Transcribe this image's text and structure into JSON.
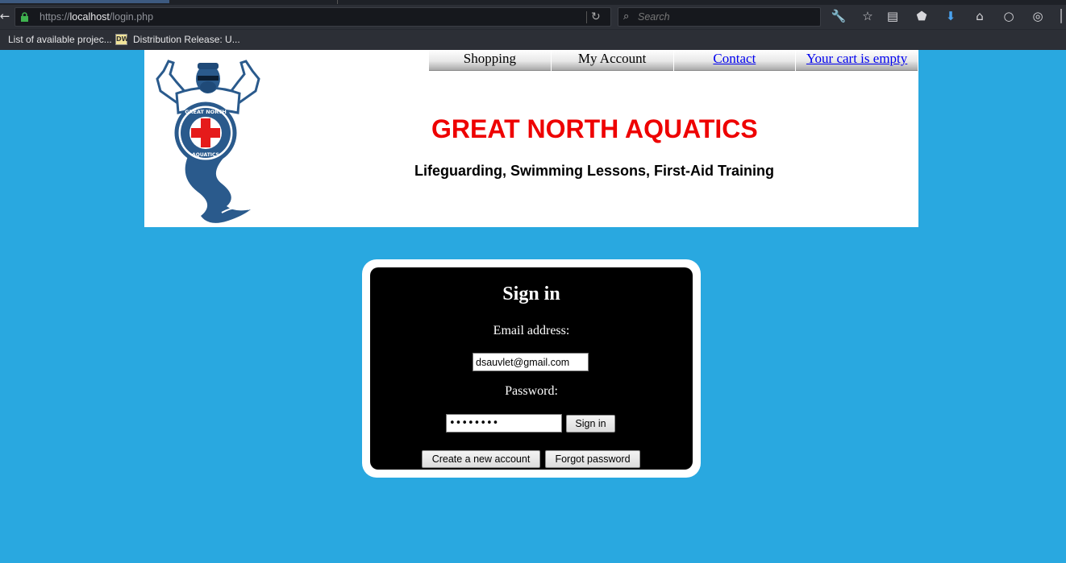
{
  "browser": {
    "url_prefix": "https://",
    "url_host": "localhost",
    "url_path": "/login.php",
    "search_placeholder": "Search",
    "bookmarks": [
      {
        "label": "List of available projec..."
      },
      {
        "label": "Distribution Release: U...",
        "icon_text": "DW"
      }
    ],
    "icons": [
      "back-icon",
      "lock-icon",
      "reload-icon",
      "search-icon",
      "wrench-icon",
      "star-icon",
      "reader-icon",
      "pocket-icon",
      "download-icon",
      "home-icon",
      "chat-icon",
      "globe-icon",
      "menu-icon"
    ]
  },
  "header": {
    "nav": [
      {
        "label": "Shopping"
      },
      {
        "label": "My Account"
      },
      {
        "label": "Contact"
      },
      {
        "label": "Your cart is empty"
      }
    ],
    "title": "GREAT NORTH AQUATICS",
    "tagline": "Lifeguarding, Swimming Lessons, First-Aid Training",
    "logo_text_top": "GREAT NORTH",
    "logo_text_bottom": "AQUATICS"
  },
  "signin": {
    "title": "Sign in",
    "email_label": "Email address:",
    "email_value": "dsauvlet@gmail.com",
    "password_label": "Password:",
    "password_value": "password",
    "signin_button": "Sign in",
    "create_account_button": "Create a new account",
    "forgot_password_button": "Forgot password"
  },
  "colors": {
    "page_background": "#29a8e0",
    "title_red": "#ee0000",
    "panel_black": "#000000"
  }
}
